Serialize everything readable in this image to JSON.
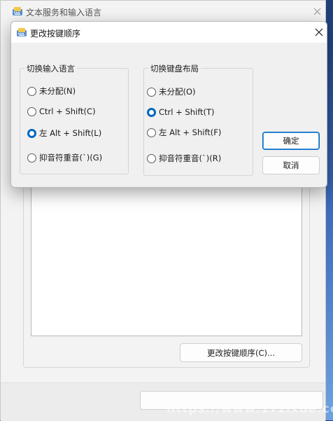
{
  "background_window": {
    "title": "文本服务和输入语言",
    "change_key_sequence_button": "更改按键顺序(C)..."
  },
  "dialog": {
    "title": "更改按键顺序",
    "input_language_group": {
      "title": "切换输入语言",
      "options": [
        {
          "label": "未分配(N)",
          "checked": false
        },
        {
          "label": "Ctrl + Shift(C)",
          "checked": false
        },
        {
          "label": "左 Alt + Shift(L)",
          "checked": true
        },
        {
          "label": "抑音符重音(`)(G)",
          "checked": false
        }
      ]
    },
    "keyboard_layout_group": {
      "title": "切换键盘布局",
      "options": [
        {
          "label": "未分配(O)",
          "checked": false
        },
        {
          "label": "Ctrl + Shift(T)",
          "checked": true
        },
        {
          "label": "左 Alt + Shift(F)",
          "checked": false
        },
        {
          "label": "抑音符重音(`)(R)",
          "checked": false
        }
      ]
    },
    "ok_label": "确定",
    "cancel_label": "取消"
  },
  "watermark": "https://www.17zixue.cc",
  "colors": {
    "accent": "#0067c0",
    "dialog_bg": "#f0f0f0",
    "window_bg": "#f3f3f3"
  }
}
